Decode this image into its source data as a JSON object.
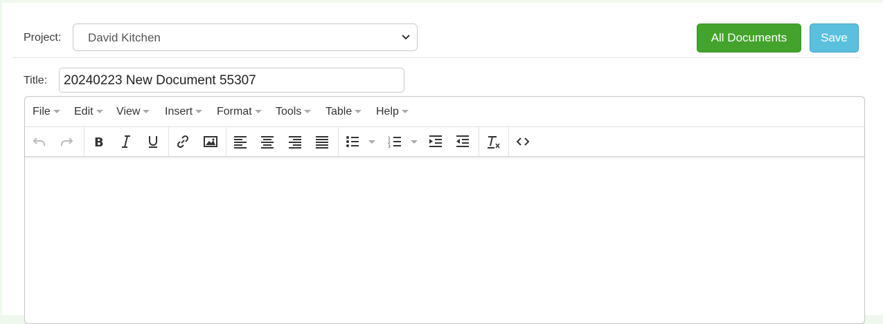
{
  "header": {
    "project_label": "Project:",
    "project_value": "David Kitchen",
    "all_documents_label": "All Documents",
    "save_label": "Save"
  },
  "title_field": {
    "label": "Title:",
    "value": "20240223 New Document 55307"
  },
  "editor": {
    "menu": [
      "File",
      "Edit",
      "View",
      "Insert",
      "Format",
      "Tools",
      "Table",
      "Help"
    ],
    "toolbar_icons": [
      "undo-icon",
      "redo-icon",
      "bold-icon",
      "italic-icon",
      "underline-icon",
      "link-icon",
      "image-icon",
      "align-left-icon",
      "align-center-icon",
      "align-right-icon",
      "align-justify-icon",
      "bullet-list-icon",
      "numbered-list-icon",
      "indent-icon",
      "outdent-icon",
      "clear-formatting-icon",
      "source-code-icon"
    ],
    "content": ""
  },
  "colors": {
    "primary_green": "#43a32c",
    "save_blue": "#5bc0de",
    "background": "#eef8ec"
  }
}
